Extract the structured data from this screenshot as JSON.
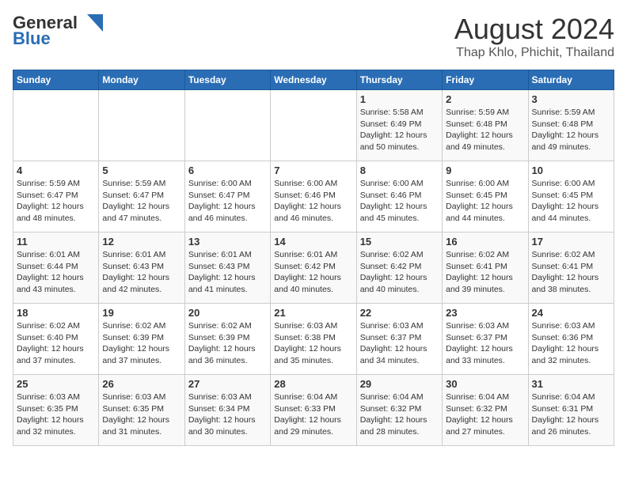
{
  "header": {
    "logo_general": "General",
    "logo_blue": "Blue",
    "month_year": "August 2024",
    "location": "Thap Khlo, Phichit, Thailand"
  },
  "days_of_week": [
    "Sunday",
    "Monday",
    "Tuesday",
    "Wednesday",
    "Thursday",
    "Friday",
    "Saturday"
  ],
  "weeks": [
    [
      {
        "day": "",
        "info": ""
      },
      {
        "day": "",
        "info": ""
      },
      {
        "day": "",
        "info": ""
      },
      {
        "day": "",
        "info": ""
      },
      {
        "day": "1",
        "info": "Sunrise: 5:58 AM\nSunset: 6:49 PM\nDaylight: 12 hours\nand 50 minutes."
      },
      {
        "day": "2",
        "info": "Sunrise: 5:59 AM\nSunset: 6:48 PM\nDaylight: 12 hours\nand 49 minutes."
      },
      {
        "day": "3",
        "info": "Sunrise: 5:59 AM\nSunset: 6:48 PM\nDaylight: 12 hours\nand 49 minutes."
      }
    ],
    [
      {
        "day": "4",
        "info": "Sunrise: 5:59 AM\nSunset: 6:47 PM\nDaylight: 12 hours\nand 48 minutes."
      },
      {
        "day": "5",
        "info": "Sunrise: 5:59 AM\nSunset: 6:47 PM\nDaylight: 12 hours\nand 47 minutes."
      },
      {
        "day": "6",
        "info": "Sunrise: 6:00 AM\nSunset: 6:47 PM\nDaylight: 12 hours\nand 46 minutes."
      },
      {
        "day": "7",
        "info": "Sunrise: 6:00 AM\nSunset: 6:46 PM\nDaylight: 12 hours\nand 46 minutes."
      },
      {
        "day": "8",
        "info": "Sunrise: 6:00 AM\nSunset: 6:46 PM\nDaylight: 12 hours\nand 45 minutes."
      },
      {
        "day": "9",
        "info": "Sunrise: 6:00 AM\nSunset: 6:45 PM\nDaylight: 12 hours\nand 44 minutes."
      },
      {
        "day": "10",
        "info": "Sunrise: 6:00 AM\nSunset: 6:45 PM\nDaylight: 12 hours\nand 44 minutes."
      }
    ],
    [
      {
        "day": "11",
        "info": "Sunrise: 6:01 AM\nSunset: 6:44 PM\nDaylight: 12 hours\nand 43 minutes."
      },
      {
        "day": "12",
        "info": "Sunrise: 6:01 AM\nSunset: 6:43 PM\nDaylight: 12 hours\nand 42 minutes."
      },
      {
        "day": "13",
        "info": "Sunrise: 6:01 AM\nSunset: 6:43 PM\nDaylight: 12 hours\nand 41 minutes."
      },
      {
        "day": "14",
        "info": "Sunrise: 6:01 AM\nSunset: 6:42 PM\nDaylight: 12 hours\nand 40 minutes."
      },
      {
        "day": "15",
        "info": "Sunrise: 6:02 AM\nSunset: 6:42 PM\nDaylight: 12 hours\nand 40 minutes."
      },
      {
        "day": "16",
        "info": "Sunrise: 6:02 AM\nSunset: 6:41 PM\nDaylight: 12 hours\nand 39 minutes."
      },
      {
        "day": "17",
        "info": "Sunrise: 6:02 AM\nSunset: 6:41 PM\nDaylight: 12 hours\nand 38 minutes."
      }
    ],
    [
      {
        "day": "18",
        "info": "Sunrise: 6:02 AM\nSunset: 6:40 PM\nDaylight: 12 hours\nand 37 minutes."
      },
      {
        "day": "19",
        "info": "Sunrise: 6:02 AM\nSunset: 6:39 PM\nDaylight: 12 hours\nand 37 minutes."
      },
      {
        "day": "20",
        "info": "Sunrise: 6:02 AM\nSunset: 6:39 PM\nDaylight: 12 hours\nand 36 minutes."
      },
      {
        "day": "21",
        "info": "Sunrise: 6:03 AM\nSunset: 6:38 PM\nDaylight: 12 hours\nand 35 minutes."
      },
      {
        "day": "22",
        "info": "Sunrise: 6:03 AM\nSunset: 6:37 PM\nDaylight: 12 hours\nand 34 minutes."
      },
      {
        "day": "23",
        "info": "Sunrise: 6:03 AM\nSunset: 6:37 PM\nDaylight: 12 hours\nand 33 minutes."
      },
      {
        "day": "24",
        "info": "Sunrise: 6:03 AM\nSunset: 6:36 PM\nDaylight: 12 hours\nand 32 minutes."
      }
    ],
    [
      {
        "day": "25",
        "info": "Sunrise: 6:03 AM\nSunset: 6:35 PM\nDaylight: 12 hours\nand 32 minutes."
      },
      {
        "day": "26",
        "info": "Sunrise: 6:03 AM\nSunset: 6:35 PM\nDaylight: 12 hours\nand 31 minutes."
      },
      {
        "day": "27",
        "info": "Sunrise: 6:03 AM\nSunset: 6:34 PM\nDaylight: 12 hours\nand 30 minutes."
      },
      {
        "day": "28",
        "info": "Sunrise: 6:04 AM\nSunset: 6:33 PM\nDaylight: 12 hours\nand 29 minutes."
      },
      {
        "day": "29",
        "info": "Sunrise: 6:04 AM\nSunset: 6:32 PM\nDaylight: 12 hours\nand 28 minutes."
      },
      {
        "day": "30",
        "info": "Sunrise: 6:04 AM\nSunset: 6:32 PM\nDaylight: 12 hours\nand 27 minutes."
      },
      {
        "day": "31",
        "info": "Sunrise: 6:04 AM\nSunset: 6:31 PM\nDaylight: 12 hours\nand 26 minutes."
      }
    ]
  ]
}
